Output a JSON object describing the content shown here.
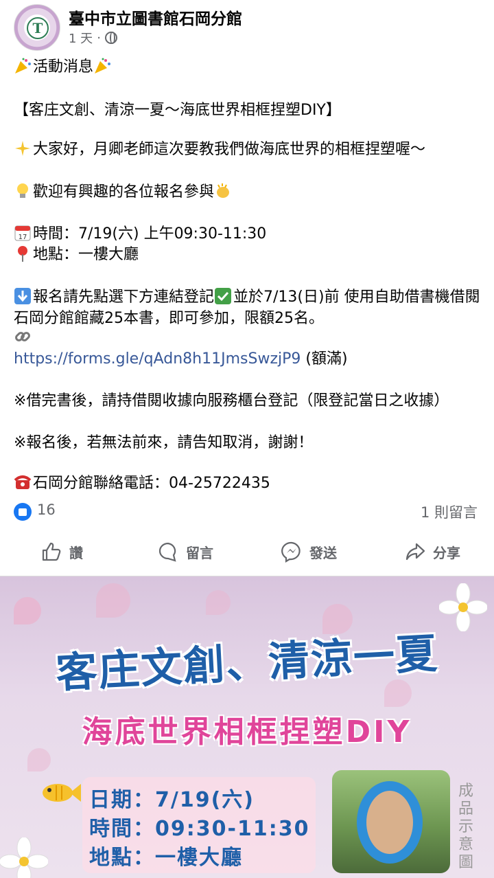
{
  "post": {
    "page_name": "臺中市立圖書館石岡分館",
    "time": "1 天",
    "separator": "·"
  },
  "content": {
    "heading": "活動消息",
    "title": "【客庄文創、清涼一夏～海底世界相框捏塑DIY】",
    "intro_line1": "大家好，月卿老師這次要教我們做海底世界的相框捏塑喔～",
    "intro_line2": "歡迎有興趣的各位報名參與",
    "time_line": "時間：7/19(六) 上午09:30-11:30",
    "place_line": "地點：一樓大廳",
    "signup_a": "報名請先點選下方連結登記",
    "signup_b": "並於7/13(日)前 使用自助借書機借閱石岡分館館藏25本書，即可參加，限額25名。",
    "link_url": "https://forms.gle/qAdn8h11JmsSwzjP9",
    "link_note": " (額滿)",
    "note1": "※借完書後，請持借閱收據向服務櫃台登記（限登記當日之收據）",
    "note2": "※報名後，若無法前來，請告知取消，謝謝！",
    "phone_line": "石岡分館聯絡電話：04-25722435"
  },
  "stats": {
    "likes": "16",
    "comments": "1 則留言"
  },
  "actions": {
    "like": "讚",
    "comment": "留言",
    "send": "發送",
    "share": "分享"
  },
  "banner": {
    "title1": "客庄文創、清涼一夏",
    "title2": "海底世界相框捏塑DIY",
    "date": "日期：7/19(六)",
    "time": "時間：09:30-11:30",
    "place": "地點：一樓大廳",
    "photo_label": "成品示意圖"
  },
  "colors": {
    "accent": "#1877f2",
    "link": "#385898",
    "muted": "#65676b",
    "banner_blue": "#1f5fa8",
    "banner_pink": "#e0459a"
  }
}
